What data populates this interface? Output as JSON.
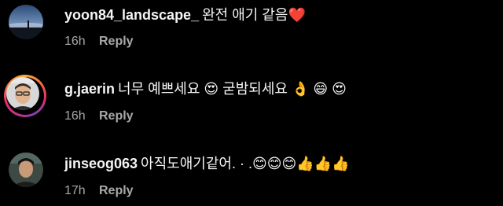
{
  "comments": [
    {
      "username": "yoon84_landscape_",
      "text": "완전 애기 같음❤️",
      "time": "16h",
      "reply_label": "Reply",
      "avatar_icon": "landscape-avatar-icon",
      "avatar_ring": false
    },
    {
      "username": "g.jaerin",
      "text": "너무 예쁘세요 😍 굳밤되세요 👌 😄 😍",
      "time": "16h",
      "reply_label": "Reply",
      "avatar_icon": "person-avatar-icon",
      "avatar_ring": true
    },
    {
      "username": "jinseog063",
      "text": "아직도애기같어. · .😊😊😊👍👍👍",
      "time": "17h",
      "reply_label": "Reply",
      "avatar_icon": "person-avatar-icon",
      "avatar_ring": false
    }
  ],
  "colors": {
    "background": "#000000",
    "primary_text": "#f5f5f5",
    "secondary_text": "#a8a8a8",
    "story_ring_start": "#c13584",
    "story_ring_end": "#fcaf45"
  }
}
